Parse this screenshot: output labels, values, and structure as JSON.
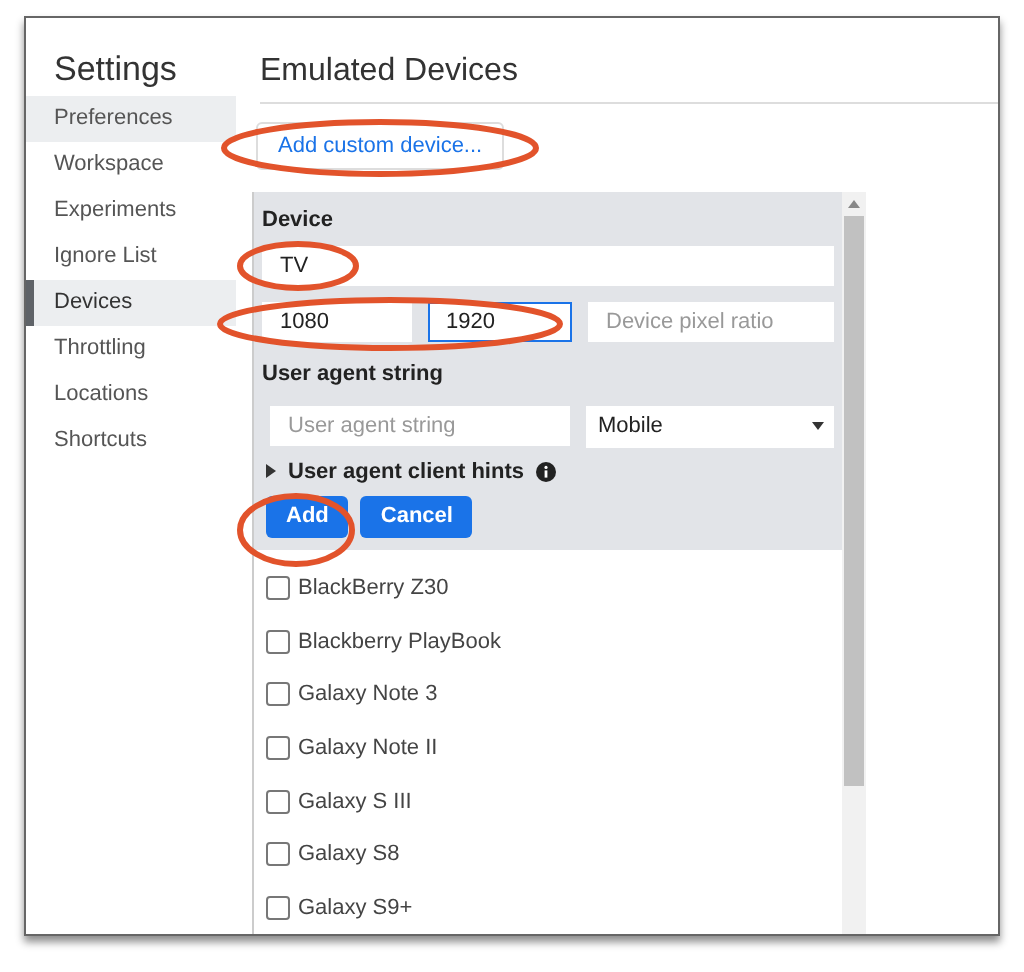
{
  "sidebar": {
    "title": "Settings",
    "items": [
      {
        "label": "Preferences",
        "selected": false,
        "hovered": true
      },
      {
        "label": "Workspace",
        "selected": false,
        "hovered": false
      },
      {
        "label": "Experiments",
        "selected": false,
        "hovered": false
      },
      {
        "label": "Ignore List",
        "selected": false,
        "hovered": false
      },
      {
        "label": "Devices",
        "selected": true,
        "hovered": false
      },
      {
        "label": "Throttling",
        "selected": false,
        "hovered": false
      },
      {
        "label": "Locations",
        "selected": false,
        "hovered": false
      },
      {
        "label": "Shortcuts",
        "selected": false,
        "hovered": false
      }
    ]
  },
  "main": {
    "title": "Emulated Devices",
    "add_button": "Add custom device...",
    "editor": {
      "device_label": "Device",
      "name_value": "TV",
      "width_value": "1080",
      "height_value": "1920",
      "dpr_placeholder": "Device pixel ratio",
      "ua_label": "User agent string",
      "ua_placeholder": "User agent string",
      "ua_type": "Mobile",
      "client_hints": "User agent client hints",
      "client_hints_expanded": false,
      "buttons": [
        "Add",
        "Cancel"
      ]
    },
    "devices": [
      {
        "label": "BlackBerry Z30",
        "checked": false
      },
      {
        "label": "Blackberry PlayBook",
        "checked": false
      },
      {
        "label": "Galaxy Note 3",
        "checked": false
      },
      {
        "label": "Galaxy Note II",
        "checked": false
      },
      {
        "label": "Galaxy S III",
        "checked": false
      },
      {
        "label": "Galaxy S8",
        "checked": false
      },
      {
        "label": "Galaxy S9+",
        "checked": false
      }
    ]
  }
}
